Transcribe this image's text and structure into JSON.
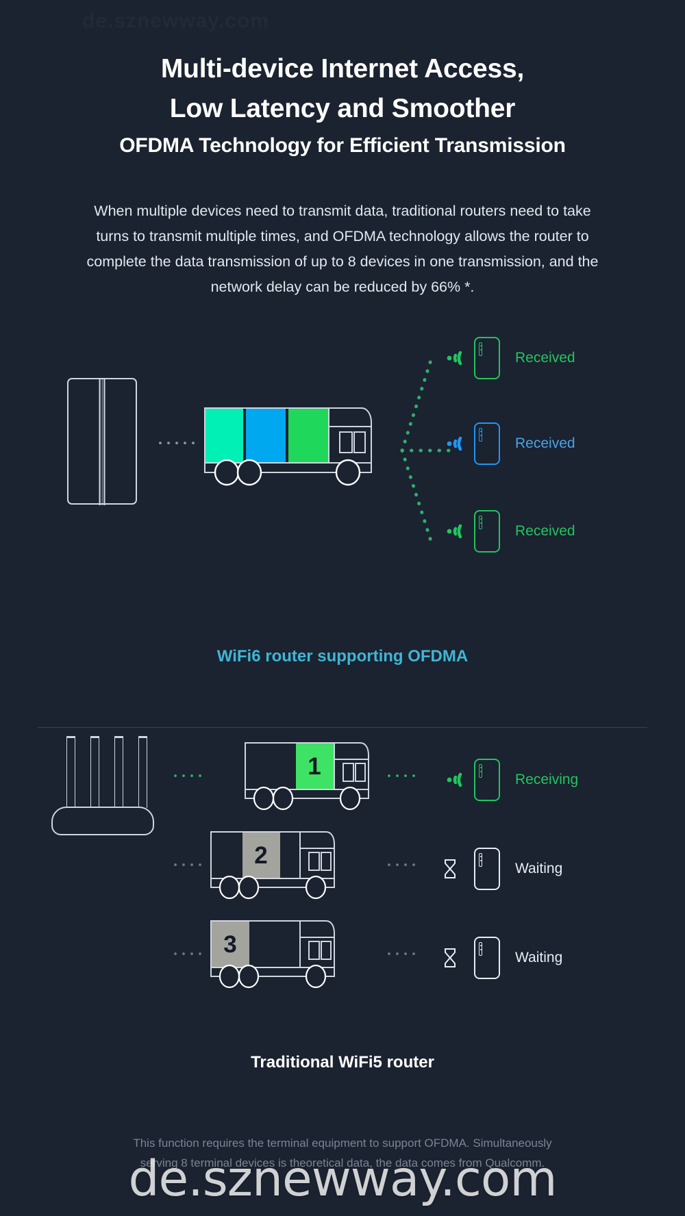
{
  "watermark": {
    "top_text": "de.sznewway.com",
    "bottom_text": "de.sznewway.com"
  },
  "heading": {
    "line1": "Multi-device Internet Access,",
    "line2": "Low Latency and Smoother",
    "subtitle": "OFDMA Technology for Efficient Transmission"
  },
  "body": {
    "paragraph": "When multiple devices need to transmit data, traditional routers need to take turns to transmit multiple times, and OFDMA technology allows the router to complete the data transmission of up to 8 devices in one transmission, and the network delay can be reduced by 66% *."
  },
  "colors": {
    "background": "#1b2230",
    "outline": "#cfd6e0",
    "green": "#22c55e",
    "bright_green": "#27e05a",
    "cyan": "#00f0b5",
    "blue": "#00a8f0",
    "caption_cyan": "#3fb6d4",
    "gray_block": "#a3a49e",
    "footnote": "#7b8495",
    "divider": "#39414f"
  },
  "wifi6_section": {
    "caption": "WiFi6 router supporting OFDMA",
    "cargo_blocks": [
      {
        "label": "",
        "color": "#00f0b5"
      },
      {
        "label": "",
        "color": "#00a8f0"
      },
      {
        "label": "",
        "color": "#1fd75a"
      }
    ],
    "clients": [
      {
        "status": "Received",
        "color": "#22c55e",
        "icon": "wifi-signal-icon"
      },
      {
        "status": "Received",
        "color": "#2196f3",
        "icon": "wifi-signal-icon"
      },
      {
        "status": "Received",
        "color": "#22c55e",
        "icon": "wifi-signal-icon"
      }
    ]
  },
  "wifi5_section": {
    "caption": "Traditional WiFi5 router",
    "rows": [
      {
        "number": "1",
        "block_color": "#3ee264",
        "status": "Receiving",
        "status_color": "#22c55e",
        "icon": "wifi-signal-icon",
        "active": true
      },
      {
        "number": "2",
        "block_color": "#a3a49e",
        "status": "Waiting",
        "status_color": "#e9edf3",
        "icon": "hourglass-icon",
        "active": false
      },
      {
        "number": "3",
        "block_color": "#a3a49e",
        "status": "Waiting",
        "status_color": "#e9edf3",
        "icon": "hourglass-icon",
        "active": false
      }
    ]
  },
  "footnote": {
    "line1": "This function requires the terminal equipment to support OFDMA. Simultaneously",
    "line2": "serving 8 terminal devices is theoretical data, the data comes from Qualcomm."
  }
}
